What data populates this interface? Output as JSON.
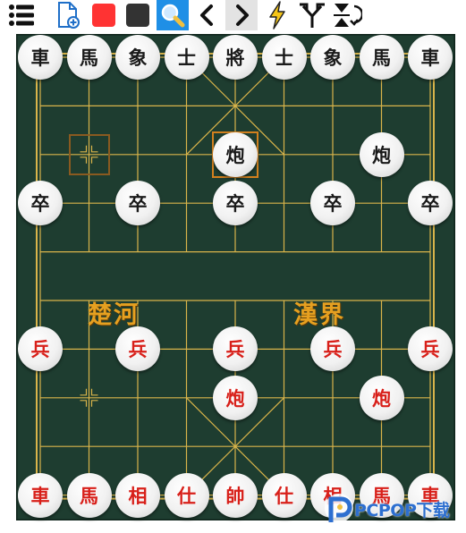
{
  "toolbar": {
    "items": [
      {
        "name": "menu-icon",
        "state": "normal"
      },
      {
        "name": "new-document-icon",
        "state": "normal"
      },
      {
        "name": "red-square-icon",
        "color": "#ff3333",
        "state": "normal"
      },
      {
        "name": "black-square-icon",
        "color": "#333333",
        "state": "normal"
      },
      {
        "name": "search-icon",
        "state": "active"
      },
      {
        "name": "chevron-left-icon",
        "state": "normal"
      },
      {
        "name": "chevron-right-icon",
        "state": "hover"
      },
      {
        "name": "lightning-icon",
        "state": "normal"
      },
      {
        "name": "branch-icon",
        "state": "normal"
      },
      {
        "name": "flip-icon",
        "state": "normal"
      }
    ]
  },
  "board": {
    "river_left": "楚河",
    "river_right": "漢界",
    "colors": {
      "felt": "#1e3d30",
      "lines": "#d9b44a",
      "river_text": "#e6a020",
      "red_piece": "#d8201a",
      "black_piece": "#1a1a1a",
      "selection": "#d2801e"
    },
    "pieces": [
      {
        "t": "車",
        "side": "black",
        "col": 0,
        "row": 0
      },
      {
        "t": "馬",
        "side": "black",
        "col": 1,
        "row": 0
      },
      {
        "t": "象",
        "side": "black",
        "col": 2,
        "row": 0
      },
      {
        "t": "士",
        "side": "black",
        "col": 3,
        "row": 0
      },
      {
        "t": "將",
        "side": "black",
        "col": 4,
        "row": 0
      },
      {
        "t": "士",
        "side": "black",
        "col": 5,
        "row": 0
      },
      {
        "t": "象",
        "side": "black",
        "col": 6,
        "row": 0
      },
      {
        "t": "馬",
        "side": "black",
        "col": 7,
        "row": 0
      },
      {
        "t": "車",
        "side": "black",
        "col": 8,
        "row": 0
      },
      {
        "t": "炮",
        "side": "black",
        "col": 4,
        "row": 2
      },
      {
        "t": "炮",
        "side": "black",
        "col": 7,
        "row": 2
      },
      {
        "t": "卒",
        "side": "black",
        "col": 0,
        "row": 3
      },
      {
        "t": "卒",
        "side": "black",
        "col": 2,
        "row": 3
      },
      {
        "t": "卒",
        "side": "black",
        "col": 4,
        "row": 3
      },
      {
        "t": "卒",
        "side": "black",
        "col": 6,
        "row": 3
      },
      {
        "t": "卒",
        "side": "black",
        "col": 8,
        "row": 3
      },
      {
        "t": "兵",
        "side": "red",
        "col": 0,
        "row": 6
      },
      {
        "t": "兵",
        "side": "red",
        "col": 2,
        "row": 6
      },
      {
        "t": "兵",
        "side": "red",
        "col": 4,
        "row": 6
      },
      {
        "t": "兵",
        "side": "red",
        "col": 6,
        "row": 6
      },
      {
        "t": "兵",
        "side": "red",
        "col": 8,
        "row": 6
      },
      {
        "t": "炮",
        "side": "red",
        "col": 4,
        "row": 7
      },
      {
        "t": "炮",
        "side": "red",
        "col": 7,
        "row": 7
      },
      {
        "t": "車",
        "side": "red",
        "col": 0,
        "row": 9
      },
      {
        "t": "馬",
        "side": "red",
        "col": 1,
        "row": 9
      },
      {
        "t": "相",
        "side": "red",
        "col": 2,
        "row": 9
      },
      {
        "t": "仕",
        "side": "red",
        "col": 3,
        "row": 9
      },
      {
        "t": "帥",
        "side": "red",
        "col": 4,
        "row": 9
      },
      {
        "t": "仕",
        "side": "red",
        "col": 5,
        "row": 9
      },
      {
        "t": "相",
        "side": "red",
        "col": 6,
        "row": 9
      },
      {
        "t": "馬",
        "side": "red",
        "col": 7,
        "row": 9
      },
      {
        "t": "車",
        "side": "red",
        "col": 8,
        "row": 9
      }
    ],
    "selected": {
      "col": 4,
      "row": 2
    },
    "last_move_from": {
      "col": 1,
      "row": 2
    }
  },
  "watermark": {
    "text": "PCPOP下载"
  }
}
